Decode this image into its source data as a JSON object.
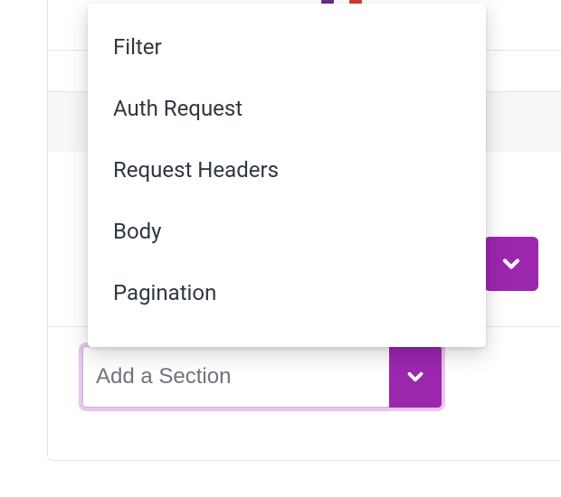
{
  "colors": {
    "accent": "#9b27af",
    "accent_glow": "#dc91e8",
    "border": "#e3e5e8",
    "text": "#2f3740",
    "dot_purple": "#6a2d8a",
    "dot_red": "#d73b30"
  },
  "combobox": {
    "placeholder": "Add a Section",
    "value": "",
    "chevron_icon": "chevron-down-icon"
  },
  "right_button": {
    "icon": "chevron-down-icon"
  },
  "dropdown": {
    "open": true,
    "items": [
      {
        "label": "Filter"
      },
      {
        "label": "Auth Request"
      },
      {
        "label": "Request Headers"
      },
      {
        "label": "Body"
      },
      {
        "label": "Pagination"
      }
    ]
  }
}
